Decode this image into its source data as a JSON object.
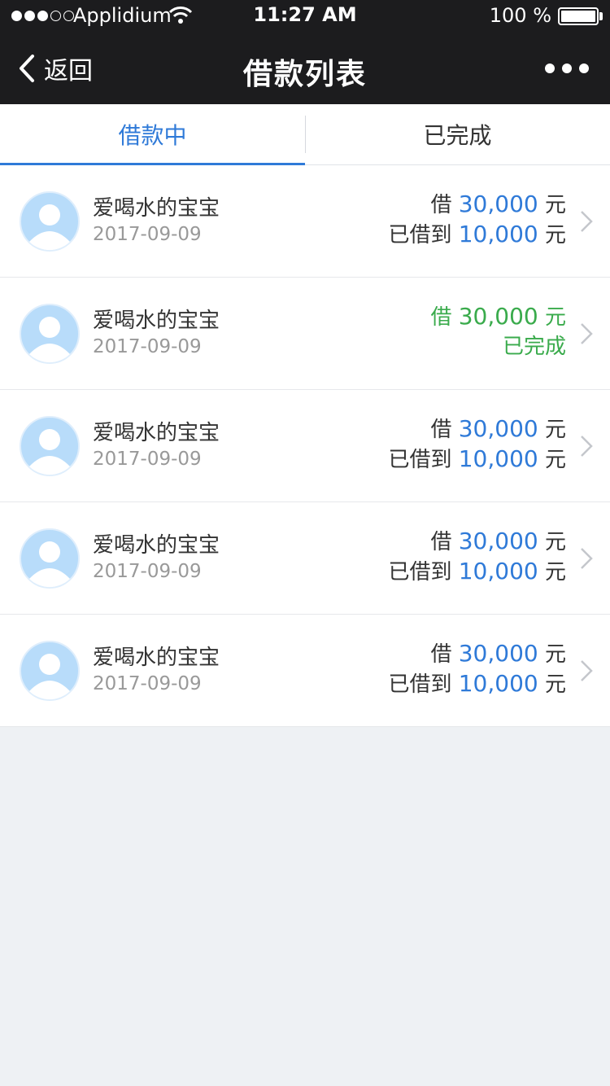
{
  "status_bar": {
    "carrier": "Applidium",
    "time": "11:27 AM",
    "battery": "100 %"
  },
  "nav": {
    "back_label": "返回",
    "title": "借款列表"
  },
  "tabs": [
    {
      "label": "借款中",
      "active": true
    },
    {
      "label": "已完成",
      "active": false
    }
  ],
  "loans": [
    {
      "name": "爱喝水的宝宝",
      "date": "2017-09-09",
      "borrow_prefix": "借",
      "borrow_amount": "30,000",
      "unit": "元",
      "status_prefix": "已借到",
      "status_amount": "10,000",
      "status_unit": "元"
    },
    {
      "name": "爱喝水的宝宝",
      "date": "2017-09-09",
      "borrow_prefix": "借",
      "borrow_amount": "30,000",
      "unit": "元",
      "status_text": "已完成",
      "completed": true
    },
    {
      "name": "爱喝水的宝宝",
      "date": "2017-09-09",
      "borrow_prefix": "借",
      "borrow_amount": "30,000",
      "unit": "元",
      "status_prefix": "已借到",
      "status_amount": "10,000",
      "status_unit": "元"
    },
    {
      "name": "爱喝水的宝宝",
      "date": "2017-09-09",
      "borrow_prefix": "借",
      "borrow_amount": "30,000",
      "unit": "元",
      "status_prefix": "已借到",
      "status_amount": "10,000",
      "status_unit": "元"
    },
    {
      "name": "爱喝水的宝宝",
      "date": "2017-09-09",
      "borrow_prefix": "借",
      "borrow_amount": "30,000",
      "unit": "元",
      "status_prefix": "已借到",
      "status_amount": "10,000",
      "status_unit": "元"
    }
  ],
  "colors": {
    "accent": "#2f7ad8",
    "success": "#3aab4c",
    "header_bg": "#1c1c1e"
  }
}
